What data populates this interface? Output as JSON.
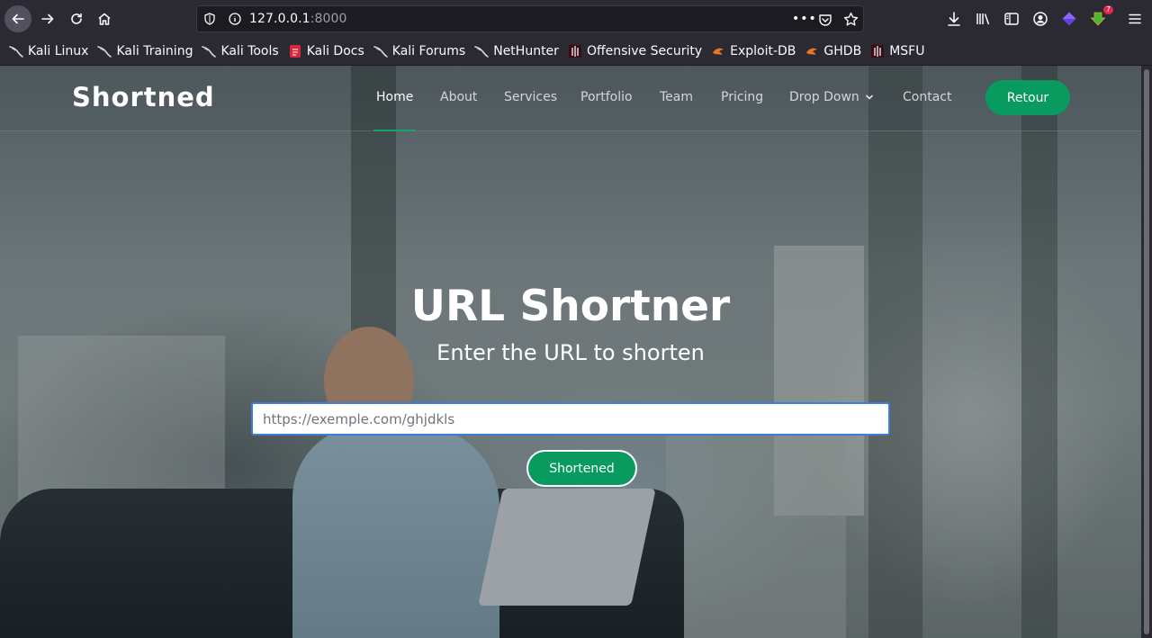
{
  "browser": {
    "url_host": "127.0.0.1",
    "url_port": ":8000",
    "more_label": "•••",
    "notification_count": "7",
    "bookmarks": [
      {
        "label": "Kali Linux",
        "icon": "kali-dragon-icon"
      },
      {
        "label": "Kali Training",
        "icon": "kali-dragon-icon"
      },
      {
        "label": "Kali Tools",
        "icon": "kali-dragon-icon"
      },
      {
        "label": "Kali Docs",
        "icon": "kali-docs-icon"
      },
      {
        "label": "Kali Forums",
        "icon": "kali-dragon-icon"
      },
      {
        "label": "NetHunter",
        "icon": "kali-dragon-icon"
      },
      {
        "label": "Offensive Security",
        "icon": "offsec-icon"
      },
      {
        "label": "Exploit-DB",
        "icon": "exploitdb-icon"
      },
      {
        "label": "GHDB",
        "icon": "exploitdb-icon"
      },
      {
        "label": "MSFU",
        "icon": "offsec-icon"
      }
    ]
  },
  "site": {
    "logo": "Shortned",
    "nav": {
      "home": "Home",
      "about": "About",
      "services": "Services",
      "portfolio": "Portfolio",
      "team": "Team",
      "pricing": "Pricing",
      "dropdown": "Drop Down",
      "contact": "Contact"
    },
    "retour_label": "Retour",
    "accent_color": "#089a5f"
  },
  "hero": {
    "title": "URL Shortner",
    "subtitle": "Enter the URL to shorten",
    "input_placeholder": "https://exemple.com/ghjdkls",
    "input_value": "",
    "button_label": "Shortened"
  }
}
